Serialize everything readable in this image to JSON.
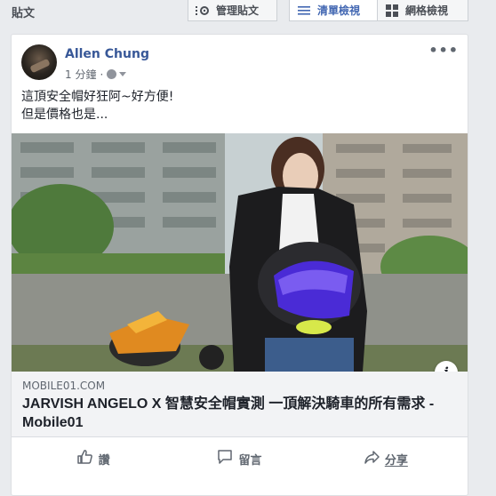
{
  "header": {
    "section_title": "貼文",
    "manage_label": "管理貼文",
    "list_view_label": "清單檢視",
    "grid_view_label": "網格檢視"
  },
  "post": {
    "author": "Allen Chung",
    "time": "1 分鐘",
    "privacy_icon": "globe-icon",
    "text_lines": [
      "這頂安全帽好狂阿~好方便!",
      "但是價格也是..."
    ],
    "link": {
      "domain": "MOBILE01.COM",
      "title": "JARVISH ANGELO X 智慧安全帽實測 一頂解決騎車的所有需求 - Mobile01"
    },
    "actions": {
      "like_label": "讚",
      "comment_label": "留言",
      "share_label": "分享"
    }
  },
  "colors": {
    "author_link": "#385898",
    "active_tab": "#4267b2",
    "link_meta_bg": "#f2f3f5"
  }
}
